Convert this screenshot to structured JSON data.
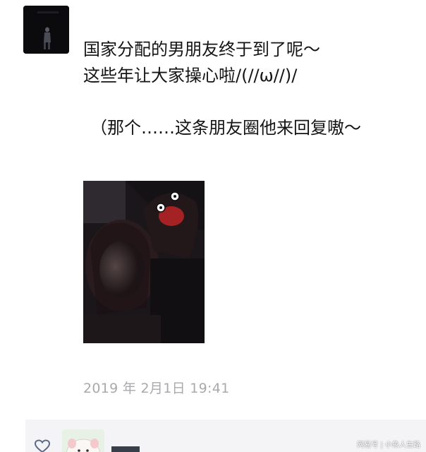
{
  "post": {
    "author_avatar_icon": "user-avatar",
    "text_lines": [
      "国家分配的男朋友终于到了呢～",
      "这些年让大家操心啦/(//ω//)/",
      "（那个……这条朋友圈他来回复嗷～"
    ],
    "photo_icon": "couple-photo",
    "timestamp": "2019 年 2月1日  19:41"
  },
  "likes": {
    "like_icon": "heart-icon",
    "liker_avatar_icon": "liker-avatar"
  },
  "watermark": {
    "text": "网易号 | 小象人生路"
  }
}
